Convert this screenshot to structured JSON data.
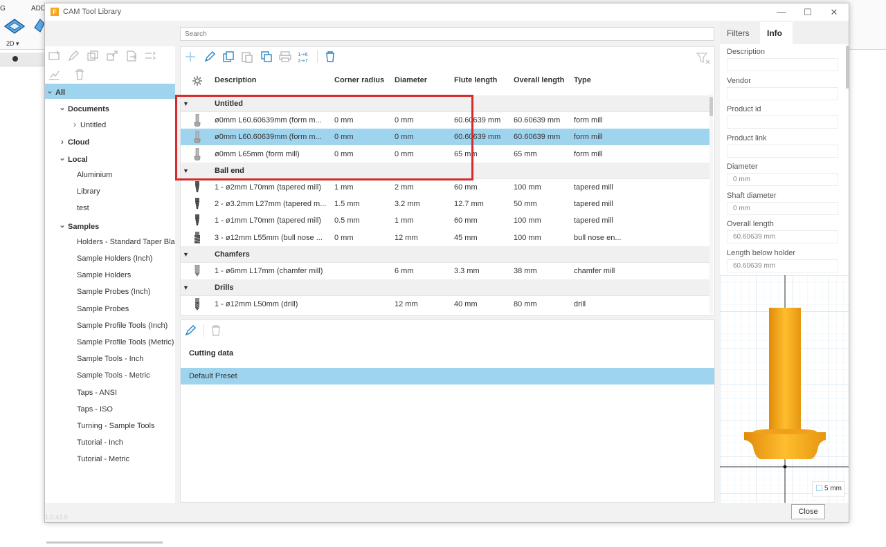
{
  "host": {
    "menu_g": "G",
    "menu_add": "ADD",
    "mode": "2D ▾"
  },
  "window": {
    "title": "CAM Tool Library",
    "logo_letter": "F",
    "minimize": "—",
    "maximize": "☐",
    "close": "✕",
    "version": "1.0.43.0"
  },
  "left": {
    "tree": [
      {
        "label": "All",
        "level": 0,
        "caret": "down",
        "bold": true,
        "selected": true
      },
      {
        "label": "Documents",
        "level": 1,
        "caret": "down",
        "bold": true
      },
      {
        "label": "Untitled",
        "level": 2,
        "caret": "right",
        "bold": false
      },
      {
        "label": "Cloud",
        "level": 1,
        "caret": "right",
        "bold": true
      },
      {
        "label": "Local",
        "level": 1,
        "caret": "down",
        "bold": true
      },
      {
        "label": "Aluminium",
        "level": 2,
        "caret": "none",
        "bold": false
      },
      {
        "label": "Library",
        "level": 2,
        "caret": "none",
        "bold": false
      },
      {
        "label": "test",
        "level": 2,
        "caret": "none",
        "bold": false
      },
      {
        "label": "Samples",
        "level": 1,
        "caret": "down",
        "bold": true
      },
      {
        "label": "Holders - Standard Taper Blanks",
        "level": 2,
        "caret": "none",
        "bold": false
      },
      {
        "label": "Sample Holders (Inch)",
        "level": 2,
        "caret": "none",
        "bold": false
      },
      {
        "label": "Sample Holders",
        "level": 2,
        "caret": "none",
        "bold": false
      },
      {
        "label": "Sample Probes (Inch)",
        "level": 2,
        "caret": "none",
        "bold": false
      },
      {
        "label": "Sample Probes",
        "level": 2,
        "caret": "none",
        "bold": false
      },
      {
        "label": "Sample Profile Tools (Inch)",
        "level": 2,
        "caret": "none",
        "bold": false
      },
      {
        "label": "Sample Profile Tools (Metric)",
        "level": 2,
        "caret": "none",
        "bold": false
      },
      {
        "label": "Sample Tools - Inch",
        "level": 2,
        "caret": "none",
        "bold": false
      },
      {
        "label": "Sample Tools - Metric",
        "level": 2,
        "caret": "none",
        "bold": false
      },
      {
        "label": "Taps - ANSI",
        "level": 2,
        "caret": "none",
        "bold": false
      },
      {
        "label": "Taps - ISO",
        "level": 2,
        "caret": "none",
        "bold": false
      },
      {
        "label": "Turning - Sample Tools",
        "level": 2,
        "caret": "none",
        "bold": false
      },
      {
        "label": "Tutorial - Inch",
        "level": 2,
        "caret": "none",
        "bold": false
      },
      {
        "label": "Tutorial - Metric",
        "level": 2,
        "caret": "none",
        "bold": false
      }
    ]
  },
  "search": {
    "placeholder": "Search"
  },
  "table": {
    "columns": [
      "Description",
      "Corner radius",
      "Diameter",
      "Flute length",
      "Overall length",
      "Type"
    ],
    "groups": [
      {
        "name": "Untitled",
        "rows": [
          {
            "desc": "ø0mm L60.60639mm (form m...",
            "corner": "0 mm",
            "diameter": "0 mm",
            "flute": "60.60639 mm",
            "overall": "60.60639 mm",
            "type": "form mill",
            "icon": "form",
            "selected": false
          },
          {
            "desc": "ø0mm L60.60639mm (form m...",
            "corner": "0 mm",
            "diameter": "0 mm",
            "flute": "60.60639 mm",
            "overall": "60.60639 mm",
            "type": "form mill",
            "icon": "form",
            "selected": true
          },
          {
            "desc": "ø0mm L65mm (form mill)",
            "corner": "0 mm",
            "diameter": "0 mm",
            "flute": "65 mm",
            "overall": "65 mm",
            "type": "form mill",
            "icon": "form",
            "selected": false
          }
        ]
      },
      {
        "name": "Ball end",
        "rows": [
          {
            "desc": "1 - ø2mm L70mm (tapered mill)",
            "corner": "1 mm",
            "diameter": "2 mm",
            "flute": "60 mm",
            "overall": "100 mm",
            "type": "tapered mill",
            "icon": "taper"
          },
          {
            "desc": "2 - ø3.2mm L27mm (tapered m...",
            "corner": "1.5 mm",
            "diameter": "3.2 mm",
            "flute": "12.7 mm",
            "overall": "50 mm",
            "type": "tapered mill",
            "icon": "taper"
          },
          {
            "desc": "1 - ø1mm L70mm (tapered mill)",
            "corner": "0.5 mm",
            "diameter": "1 mm",
            "flute": "60 mm",
            "overall": "100 mm",
            "type": "tapered mill",
            "icon": "taper"
          },
          {
            "desc": "3 - ø12mm L55mm (bull nose ...",
            "corner": "0 mm",
            "diameter": "12 mm",
            "flute": "45 mm",
            "overall": "100 mm",
            "type": "bull nose en...",
            "icon": "bull"
          }
        ]
      },
      {
        "name": "Chamfers",
        "rows": [
          {
            "desc": "1 - ø6mm L17mm (chamfer mill)",
            "corner": "",
            "diameter": "6 mm",
            "flute": "3.3 mm",
            "overall": "38 mm",
            "type": "chamfer mill",
            "icon": "chamfer"
          }
        ]
      },
      {
        "name": "Drills",
        "rows": [
          {
            "desc": "1 - ø12mm L50mm (drill)",
            "corner": "",
            "diameter": "12 mm",
            "flute": "40 mm",
            "overall": "80 mm",
            "type": "drill",
            "icon": "drill"
          }
        ]
      }
    ]
  },
  "cutting": {
    "title": "Cutting data",
    "preset": "Default Preset"
  },
  "right": {
    "tabs": [
      "Filters",
      "Info"
    ],
    "active_tab": "Info",
    "fields": [
      {
        "label": "Description",
        "value": ""
      },
      {
        "label": "Vendor",
        "value": ""
      },
      {
        "label": "Product id",
        "value": ""
      },
      {
        "label": "Product link",
        "value": ""
      },
      {
        "label": "Diameter",
        "value": "0 mm"
      },
      {
        "label": "Shaft diameter",
        "value": "0 mm"
      },
      {
        "label": "Overall length",
        "value": "60.60639 mm"
      },
      {
        "label": "Length below holder",
        "value": "60.60639 mm"
      }
    ],
    "scale": "5 mm"
  },
  "footer": {
    "close": "Close"
  },
  "colors": {
    "accent": "#2a86c6",
    "selection": "#9fd4ef",
    "annotation": "#d62a2a",
    "tool_body": "#f5a81c"
  }
}
